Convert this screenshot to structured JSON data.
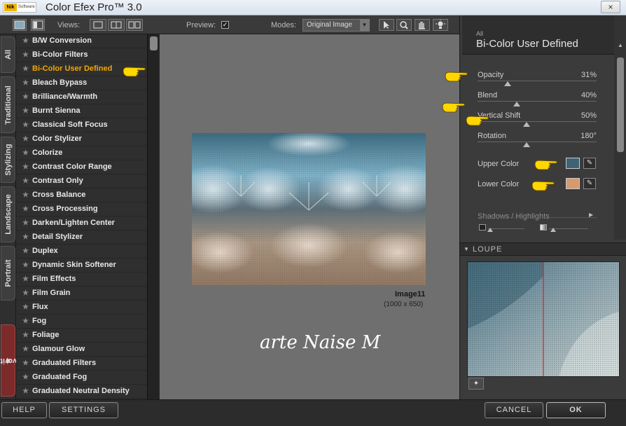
{
  "window": {
    "title": "Color Efex Pro™ 3.0",
    "logo_text": "Nik",
    "logo_sub": "Software",
    "close": "×"
  },
  "toolbar": {
    "views_label": "Views:",
    "preview_label": "Preview:",
    "modes_label": "Modes:",
    "mode_value": "Original Image"
  },
  "tabs": [
    "All",
    "Traditional",
    "Stylizing",
    "Landscape",
    "Portrait",
    "Favorites"
  ],
  "filters": [
    "B/W Conversion",
    "Bi-Color Filters",
    "Bi-Color User Defined",
    "Bleach Bypass",
    "Brilliance/Warmth",
    "Burnt Sienna",
    "Classical Soft Focus",
    "Color Stylizer",
    "Colorize",
    "Contrast Color Range",
    "Contrast Only",
    "Cross Balance",
    "Cross Processing",
    "Darken/Lighten Center",
    "Detail Stylizer",
    "Duplex",
    "Dynamic Skin Softener",
    "Film Effects",
    "Film Grain",
    "Flux",
    "Fog",
    "Foliage",
    "Glamour Glow",
    "Graduated Filters",
    "Graduated Fog",
    "Graduated Neutral Density"
  ],
  "selected_filter": "Bi-Color User Defined",
  "preview": {
    "image_name": "Image11",
    "image_size": "(1000 x 650)",
    "watermark": "arte Naise M"
  },
  "panel": {
    "category": "All",
    "title": "Bi-Color User Defined",
    "controls": [
      {
        "label": "Opacity",
        "value": "31%",
        "fraction": 0.31
      },
      {
        "label": "Blend",
        "value": "40%",
        "fraction": 0.4
      },
      {
        "label": "Vertical Shift",
        "value": "50%",
        "fraction": 0.5
      },
      {
        "label": "Rotation",
        "value": "180°",
        "fraction": 0.5
      }
    ],
    "upper_color_label": "Upper Color",
    "upper_color": "#3f6275",
    "lower_color_label": "Lower Color",
    "lower_color": "#d79a6f",
    "shadows_label": "Shadows / Highlights",
    "loupe_label": "LOUPE"
  },
  "buttons": {
    "help": "HELP",
    "settings": "SETTINGS",
    "cancel": "CANCEL",
    "ok": "OK"
  },
  "colors": {
    "accent": "#f2a600",
    "hand": "#ffd700"
  }
}
